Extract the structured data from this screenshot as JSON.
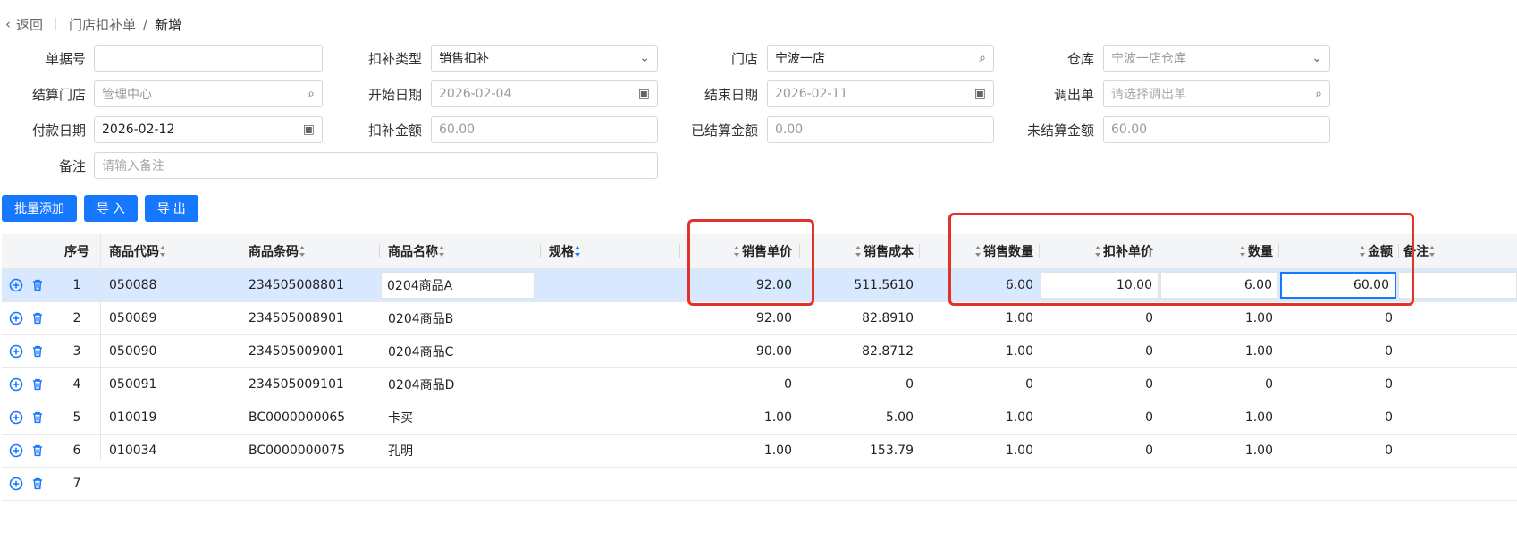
{
  "breadcrumb": {
    "back": "返回",
    "parent": "门店扣补单",
    "sep": "/",
    "current": "新增"
  },
  "form": {
    "doc_no": {
      "label": "单据号",
      "value": ""
    },
    "deduct_type": {
      "label": "扣补类型",
      "value": "销售扣补"
    },
    "store": {
      "label": "门店",
      "value": "宁波一店"
    },
    "warehouse": {
      "label": "仓库",
      "value": "宁波一店仓库"
    },
    "settle_store": {
      "label": "结算门店",
      "value": "管理中心"
    },
    "start_date": {
      "label": "开始日期",
      "value": "2026-02-04"
    },
    "end_date": {
      "label": "结束日期",
      "value": "2026-02-11"
    },
    "transfer_out": {
      "label": "调出单",
      "placeholder": "请选择调出单"
    },
    "pay_date": {
      "label": "付款日期",
      "value": "2026-02-12"
    },
    "deduct_amount": {
      "label": "扣补金额",
      "value": "60.00"
    },
    "settled_amount": {
      "label": "已结算金额",
      "value": "0.00"
    },
    "unsettled_amount": {
      "label": "未结算金额",
      "value": "60.00"
    },
    "remark": {
      "label": "备注",
      "placeholder": "请输入备注"
    }
  },
  "buttons": {
    "batch_add": "批量添加",
    "import": "导 入",
    "export": "导 出"
  },
  "table": {
    "headers": {
      "seq": "序号",
      "code": "商品代码",
      "barcode": "商品条码",
      "name": "商品名称",
      "spec": "规格",
      "sale_price": "销售单价",
      "sale_cost": "销售成本",
      "sale_qty": "销售数量",
      "deduct_price": "扣补单价",
      "qty": "数量",
      "amount": "金额",
      "remark": "备注"
    },
    "rows": [
      {
        "seq": "1",
        "code": "050088",
        "barcode": "234505008801",
        "name": "0204商品A",
        "spec": "",
        "sale_price": "92.00",
        "sale_cost": "511.5610",
        "sale_qty": "6.00",
        "deduct_price": "10.00",
        "qty": "6.00",
        "amount": "60.00"
      },
      {
        "seq": "2",
        "code": "050089",
        "barcode": "234505008901",
        "name": "0204商品B",
        "spec": "",
        "sale_price": "92.00",
        "sale_cost": "82.8910",
        "sale_qty": "1.00",
        "deduct_price": "0",
        "qty": "1.00",
        "amount": "0"
      },
      {
        "seq": "3",
        "code": "050090",
        "barcode": "234505009001",
        "name": "0204商品C",
        "spec": "",
        "sale_price": "90.00",
        "sale_cost": "82.8712",
        "sale_qty": "1.00",
        "deduct_price": "0",
        "qty": "1.00",
        "amount": "0"
      },
      {
        "seq": "4",
        "code": "050091",
        "barcode": "234505009101",
        "name": "0204商品D",
        "spec": "",
        "sale_price": "0",
        "sale_cost": "0",
        "sale_qty": "0",
        "deduct_price": "0",
        "qty": "0",
        "amount": "0"
      },
      {
        "seq": "5",
        "code": "010019",
        "barcode": "BC0000000065",
        "name": "卡买",
        "spec": "",
        "sale_price": "1.00",
        "sale_cost": "5.00",
        "sale_qty": "1.00",
        "deduct_price": "0",
        "qty": "1.00",
        "amount": "0"
      },
      {
        "seq": "6",
        "code": "010034",
        "barcode": "BC0000000075",
        "name": "孔明",
        "spec": "",
        "sale_price": "1.00",
        "sale_cost": "153.79",
        "sale_qty": "1.00",
        "deduct_price": "0",
        "qty": "1.00",
        "amount": "0"
      },
      {
        "seq": "7",
        "code": "",
        "barcode": "",
        "name": "",
        "spec": "",
        "sale_price": "",
        "sale_cost": "",
        "sale_qty": "",
        "deduct_price": "",
        "qty": "",
        "amount": ""
      }
    ]
  },
  "colors": {
    "primary": "#1677ff",
    "highlight": "#e3322b",
    "selected_row": "#d7e8ff"
  }
}
